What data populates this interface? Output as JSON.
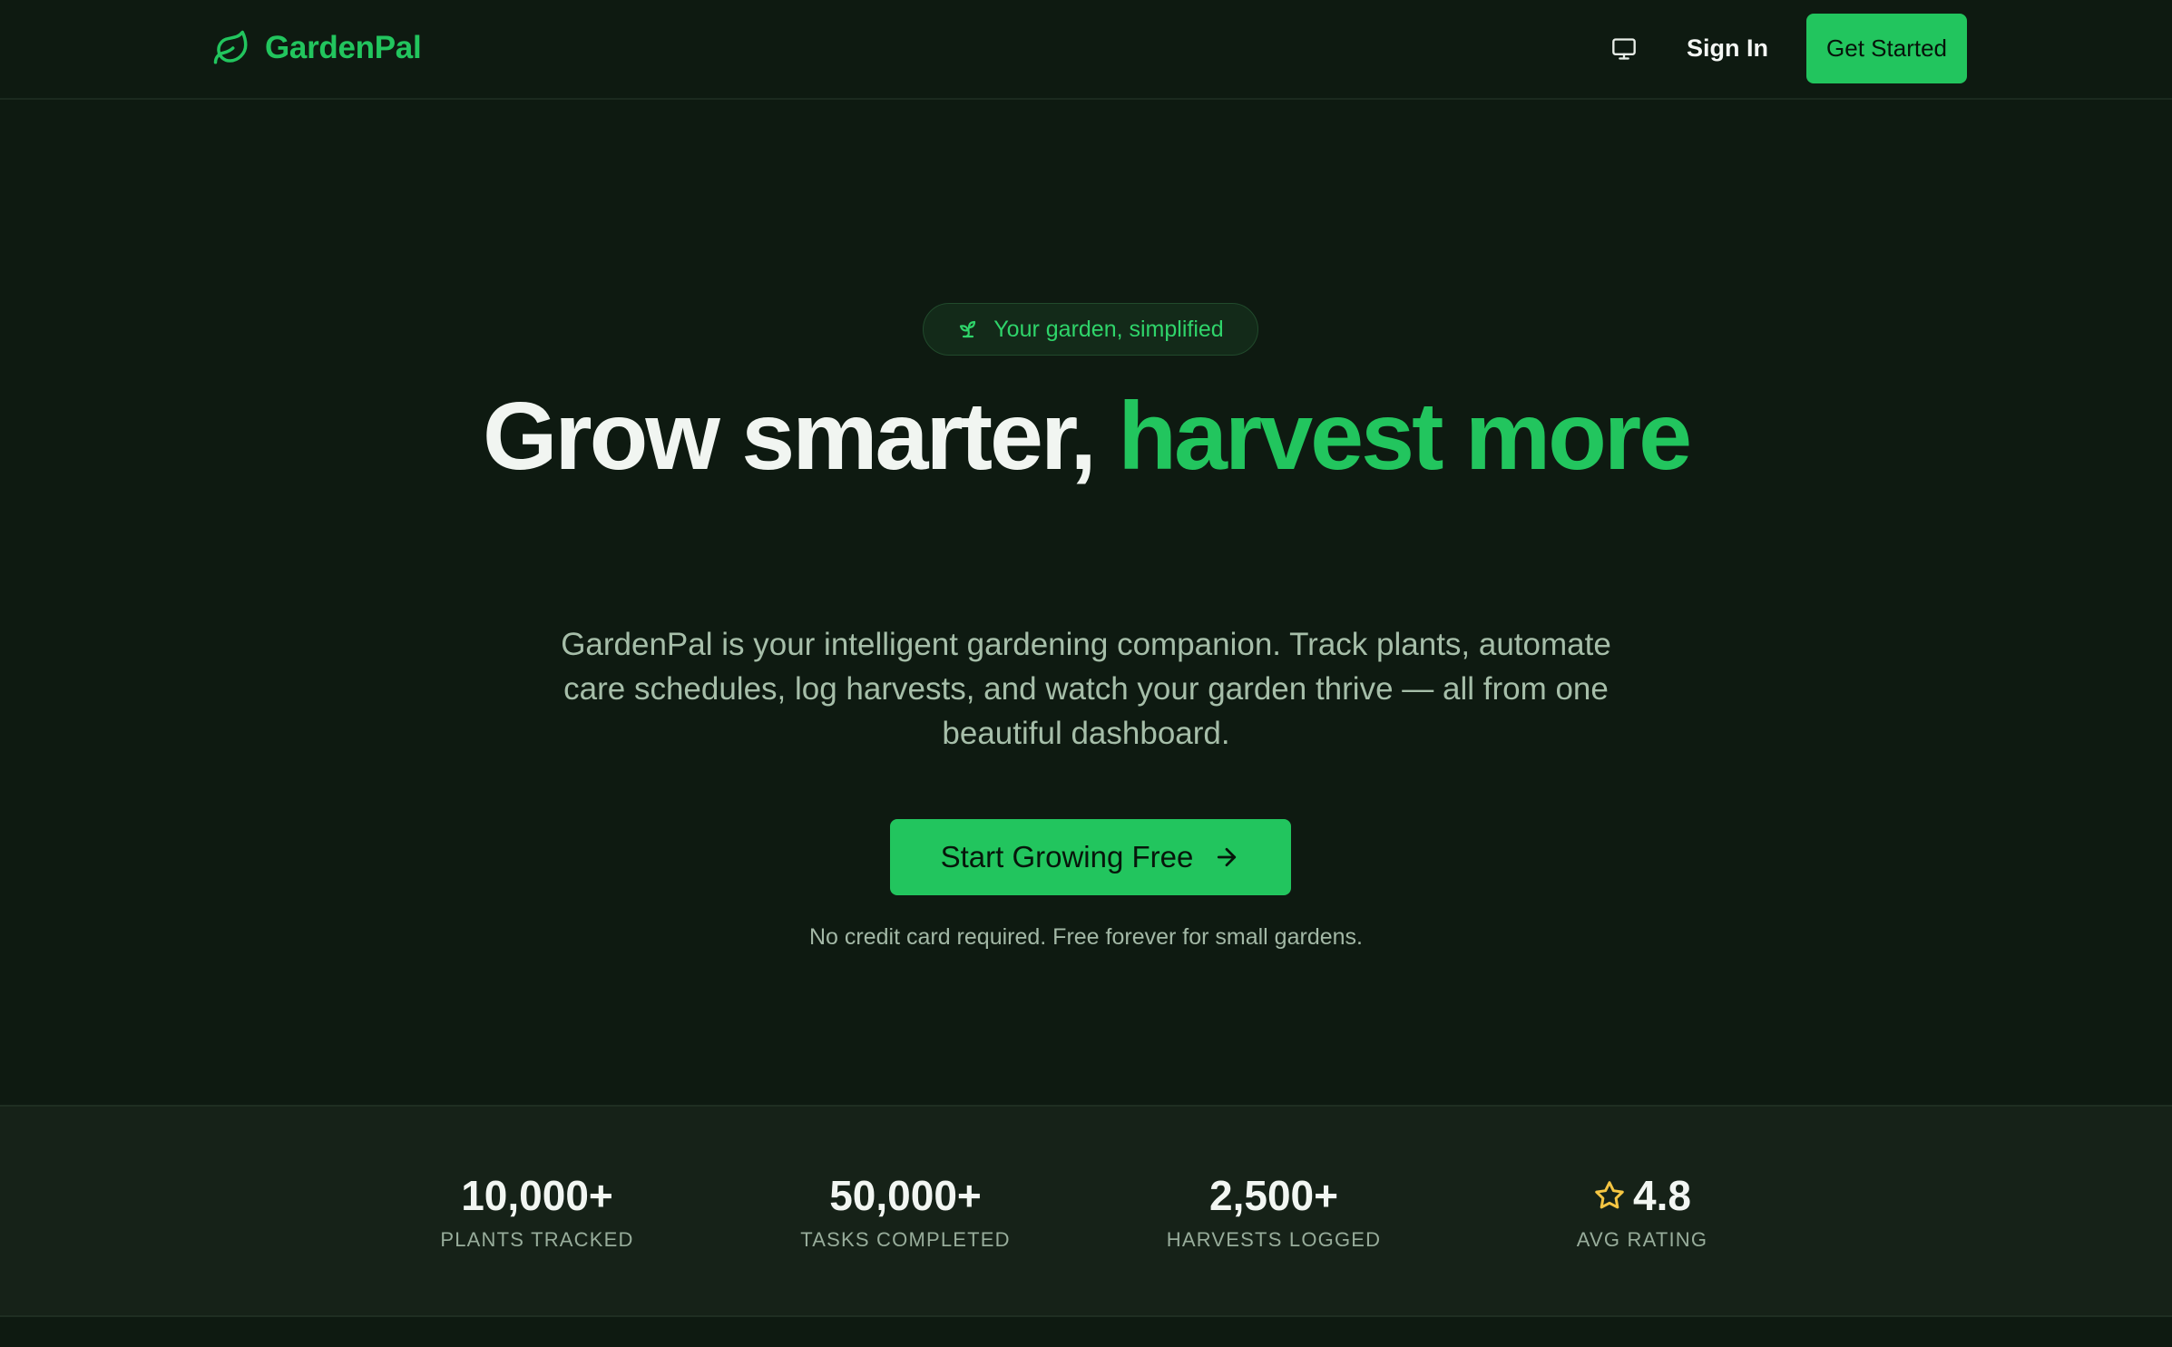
{
  "nav": {
    "brand": "GardenPal",
    "sign_in": "Sign In",
    "get_started": "Get Started",
    "theme_icon": "monitor-icon"
  },
  "hero": {
    "badge": "Your garden, simplified",
    "headline_white": "Grow smarter,",
    "headline_green": "harvest more",
    "lead": "GardenPal is your intelligent gardening companion. Track plants, automate care schedules, log harvests, and watch your garden thrive — all from one beautiful dashboard.",
    "cta": "Start Growing Free",
    "note": "No credit card required. Free forever for small gardens."
  },
  "stats": [
    {
      "value": "10,000+",
      "label": "PLANTS TRACKED"
    },
    {
      "value": "50,000+",
      "label": "TASKS COMPLETED"
    },
    {
      "value": "2,500+",
      "label": "HARVESTS LOGGED"
    },
    {
      "value": "4.8",
      "label": "AVG RATING",
      "icon": "star-icon"
    }
  ],
  "colors": {
    "background": "#0e1a11",
    "accent": "#22c55e",
    "stats_band": "#162218",
    "star": "#f5c542"
  }
}
